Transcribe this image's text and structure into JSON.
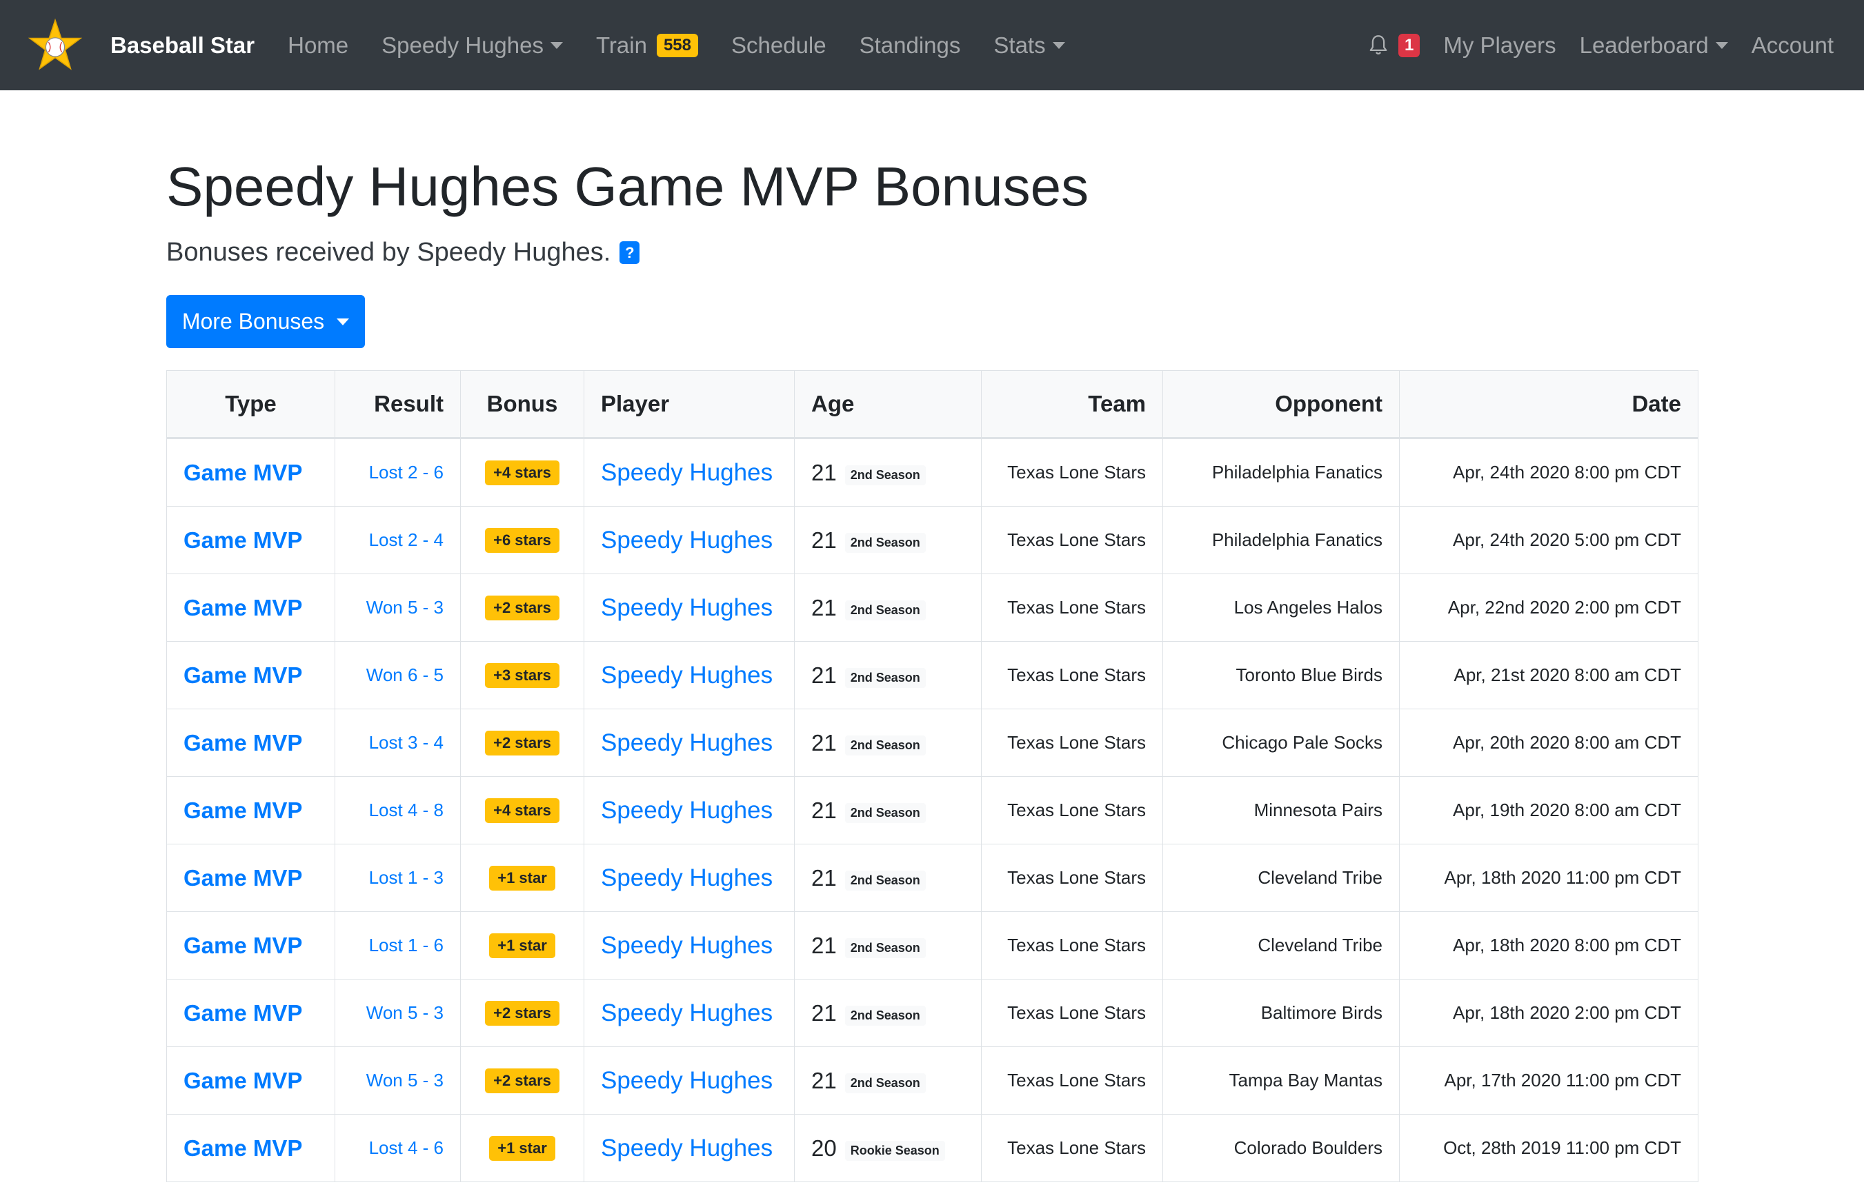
{
  "nav": {
    "brand": "Baseball Star",
    "items": [
      {
        "label": "Home",
        "dropdown": false
      },
      {
        "label": "Speedy Hughes",
        "dropdown": true
      },
      {
        "label": "Train",
        "badge": "558",
        "dropdown": false
      },
      {
        "label": "Schedule",
        "dropdown": false
      },
      {
        "label": "Standings",
        "dropdown": false
      },
      {
        "label": "Stats",
        "dropdown": true
      }
    ],
    "notifications": "1",
    "right": [
      {
        "label": "My Players",
        "dropdown": false
      },
      {
        "label": "Leaderboard",
        "dropdown": true
      },
      {
        "label": "Account",
        "dropdown": false
      }
    ]
  },
  "page": {
    "title": "Speedy Hughes Game MVP Bonuses",
    "subtitle": "Bonuses received by Speedy Hughes.",
    "help": "?",
    "more_button": "More Bonuses"
  },
  "table": {
    "headers": [
      "Type",
      "Result",
      "Bonus",
      "Player",
      "Age",
      "Team",
      "Opponent",
      "Date"
    ],
    "rows": [
      {
        "type": "Game MVP",
        "result": "Lost 2 - 6",
        "bonus": "+4 stars",
        "player": "Speedy Hughes",
        "age": "21",
        "season": "2nd Season",
        "team": "Texas Lone Stars",
        "opponent": "Philadelphia Fanatics",
        "date": "Apr, 24th 2020 8:00 pm CDT"
      },
      {
        "type": "Game MVP",
        "result": "Lost 2 - 4",
        "bonus": "+6 stars",
        "player": "Speedy Hughes",
        "age": "21",
        "season": "2nd Season",
        "team": "Texas Lone Stars",
        "opponent": "Philadelphia Fanatics",
        "date": "Apr, 24th 2020 5:00 pm CDT"
      },
      {
        "type": "Game MVP",
        "result": "Won 5 - 3",
        "bonus": "+2 stars",
        "player": "Speedy Hughes",
        "age": "21",
        "season": "2nd Season",
        "team": "Texas Lone Stars",
        "opponent": "Los Angeles Halos",
        "date": "Apr, 22nd 2020 2:00 pm CDT"
      },
      {
        "type": "Game MVP",
        "result": "Won 6 - 5",
        "bonus": "+3 stars",
        "player": "Speedy Hughes",
        "age": "21",
        "season": "2nd Season",
        "team": "Texas Lone Stars",
        "opponent": "Toronto Blue Birds",
        "date": "Apr, 21st 2020 8:00 am CDT"
      },
      {
        "type": "Game MVP",
        "result": "Lost 3 - 4",
        "bonus": "+2 stars",
        "player": "Speedy Hughes",
        "age": "21",
        "season": "2nd Season",
        "team": "Texas Lone Stars",
        "opponent": "Chicago Pale Socks",
        "date": "Apr, 20th 2020 8:00 am CDT"
      },
      {
        "type": "Game MVP",
        "result": "Lost 4 - 8",
        "bonus": "+4 stars",
        "player": "Speedy Hughes",
        "age": "21",
        "season": "2nd Season",
        "team": "Texas Lone Stars",
        "opponent": "Minnesota Pairs",
        "date": "Apr, 19th 2020 8:00 am CDT"
      },
      {
        "type": "Game MVP",
        "result": "Lost 1 - 3",
        "bonus": "+1 star",
        "player": "Speedy Hughes",
        "age": "21",
        "season": "2nd Season",
        "team": "Texas Lone Stars",
        "opponent": "Cleveland Tribe",
        "date": "Apr, 18th 2020 11:00 pm CDT"
      },
      {
        "type": "Game MVP",
        "result": "Lost 1 - 6",
        "bonus": "+1 star",
        "player": "Speedy Hughes",
        "age": "21",
        "season": "2nd Season",
        "team": "Texas Lone Stars",
        "opponent": "Cleveland Tribe",
        "date": "Apr, 18th 2020 8:00 pm CDT"
      },
      {
        "type": "Game MVP",
        "result": "Won 5 - 3",
        "bonus": "+2 stars",
        "player": "Speedy Hughes",
        "age": "21",
        "season": "2nd Season",
        "team": "Texas Lone Stars",
        "opponent": "Baltimore Birds",
        "date": "Apr, 18th 2020 2:00 pm CDT"
      },
      {
        "type": "Game MVP",
        "result": "Won 5 - 3",
        "bonus": "+2 stars",
        "player": "Speedy Hughes",
        "age": "21",
        "season": "2nd Season",
        "team": "Texas Lone Stars",
        "opponent": "Tampa Bay Mantas",
        "date": "Apr, 17th 2020 11:00 pm CDT"
      },
      {
        "type": "Game MVP",
        "result": "Lost 4 - 6",
        "bonus": "+1 star",
        "player": "Speedy Hughes",
        "age": "20",
        "season": "Rookie Season",
        "team": "Texas Lone Stars",
        "opponent": "Colorado Boulders",
        "date": "Oct, 28th 2019 11:00 pm CDT"
      }
    ]
  },
  "colors": {
    "navbar": "#343a40",
    "link": "#007bff",
    "badge_warning": "#ffc107",
    "badge_danger": "#dc3545"
  }
}
